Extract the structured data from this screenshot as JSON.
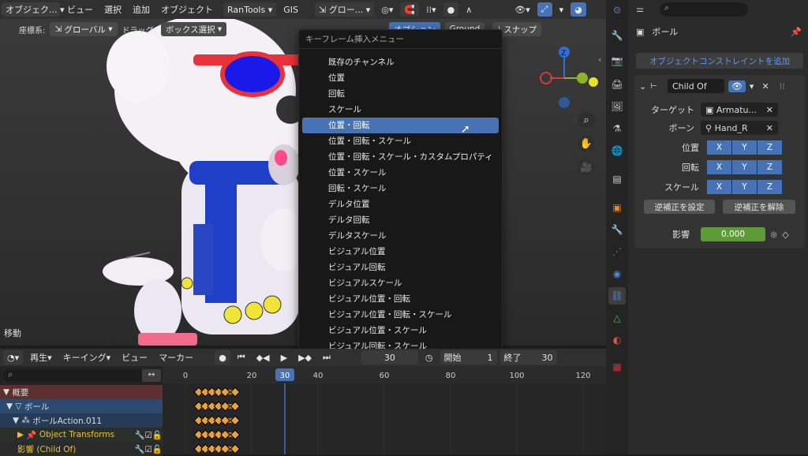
{
  "header": {
    "mode": "オブジェク...",
    "menus": [
      "ビュー",
      "選択",
      "追加",
      "オブジェクト"
    ],
    "ran_tools": "RanTools",
    "gis": "GIS",
    "orientation": "グロー..."
  },
  "viewport_header": {
    "coord_label": "座標系:",
    "coord_value": "グローバル",
    "drag_label": "ドラッグ:",
    "drag_value": "ボックス選択",
    "options": "オプション",
    "ground": "Ground",
    "snap": "スナップ"
  },
  "operator_panel": {
    "label": "移動"
  },
  "keyframe_menu": {
    "title": "キーフレーム挿入メニュー",
    "items": [
      "既存のチャンネル",
      "位置",
      "回転",
      "スケール",
      "位置・回転",
      "位置・回転・スケール",
      "位置・回転・スケール・カスタムプロパティ",
      "位置・スケール",
      "回転・スケール",
      "デルタ位置",
      "デルタ回転",
      "デルタスケール",
      "ビジュアル位置",
      "ビジュアル回転",
      "ビジュアルスケール",
      "ビジュアル位置・回転",
      "ビジュアル位置・回転・スケール",
      "ビジュアル位置・スケール",
      "ビジュアル回転・スケール"
    ],
    "highlighted_index": 4
  },
  "properties": {
    "object_name": "ボール",
    "add_constraint": "オブジェクトコンストレイントを追加",
    "constraint_name": "Child Of",
    "target_label": "ターゲット",
    "target_value": "Armatu...",
    "bone_label": "ボーン",
    "bone_value": "Hand_R",
    "location_label": "位置",
    "rotation_label": "回転",
    "scale_label": "スケール",
    "axes": [
      "X",
      "Y",
      "Z"
    ],
    "set_inverse": "逆補正を設定",
    "clear_inverse": "逆補正を解除",
    "influence_label": "影響",
    "influence_value": "0.000"
  },
  "timeline_header": {
    "playback": "再生",
    "keying": "キーイング",
    "view": "ビュー",
    "marker": "マーカー",
    "current_frame": "30",
    "start_label": "開始",
    "start_value": "1",
    "end_label": "終了",
    "end_value": "30"
  },
  "timeline": {
    "ruler": [
      "0",
      "20",
      "30",
      "40",
      "60",
      "80",
      "100",
      "120"
    ],
    "current_frame": "30",
    "channels": {
      "summary": "概要",
      "object": "ボール",
      "action": "ボールAction.011",
      "group": "Object Transforms",
      "influence": "影響 (Child Of)"
    }
  },
  "colors": {
    "accent": "#4772b3",
    "keyframe": "#e8a23a",
    "influence_bar": "#5e9a37",
    "summary_row": "#5e2f2f",
    "selected_row": "#2c4a70"
  }
}
